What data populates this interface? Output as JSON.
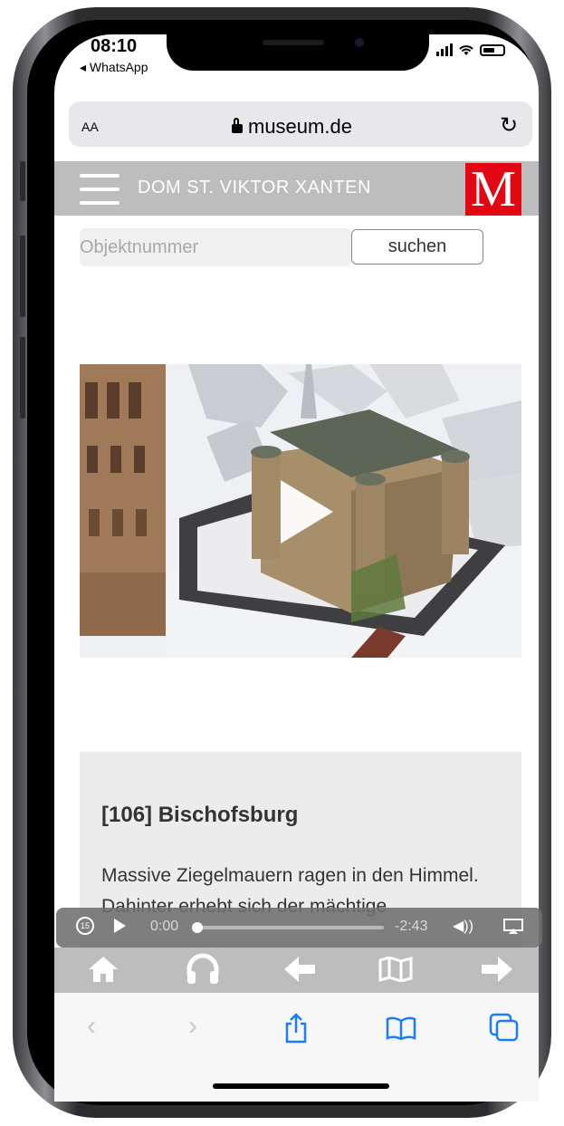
{
  "status_bar": {
    "time": "08:10",
    "back_app": "◂ WhatsApp"
  },
  "address_bar": {
    "text_size": "AA",
    "url": "museum.de",
    "reload_icon": "reload-icon"
  },
  "site_header": {
    "title": "DOM ST. VIKTOR XANTEN",
    "logo_letter": "M",
    "logo_color": "#e30613",
    "header_color": "#bdbdbd"
  },
  "search": {
    "placeholder": "Objektnummer",
    "button_label": "suchen"
  },
  "video": {
    "play_icon": "play-icon"
  },
  "object": {
    "title": "[106] Bischofsburg",
    "description": "Massive Ziegelmauern ragen in den Himmel. Dahinter erhebt sich der mächtige"
  },
  "audio_player": {
    "skip_back": "15",
    "current_time": "0:00",
    "remaining_time": "-2:43",
    "progress": 0
  },
  "app_toolbar": {
    "icons": [
      "home-icon",
      "headphones-icon",
      "arrow-left-icon",
      "map-icon",
      "arrow-right-icon"
    ]
  },
  "safari_toolbar": {
    "icons": [
      "back-icon",
      "forward-icon",
      "share-icon",
      "bookmarks-icon",
      "tabs-icon"
    ]
  }
}
